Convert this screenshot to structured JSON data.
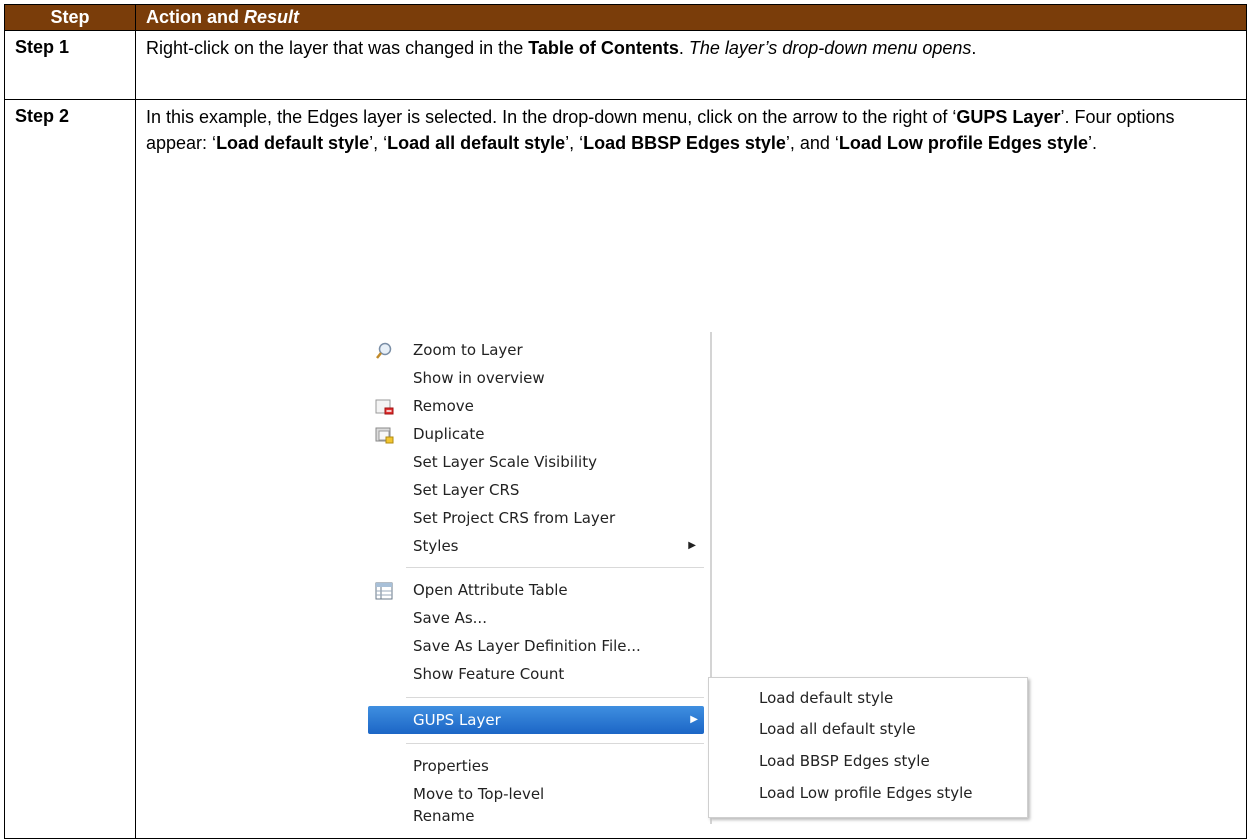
{
  "table": {
    "header": {
      "col1": "Step",
      "col2_plain": "Action and ",
      "col2_italic": "Result"
    },
    "step1": {
      "label": "Step 1",
      "t1": "Right-click on the layer that was changed in the ",
      "b1": "Table of Contents",
      "t2": ". ",
      "i1": "The layer’s drop-down menu opens",
      "t3": "."
    },
    "step2": {
      "label": "Step 2",
      "t1": "In this example, the Edges layer is selected. In the drop-down menu, click on the arrow to the right of ‘",
      "b1": "GUPS Layer",
      "t2": "’. Four options appear: ‘",
      "b2": "Load default style",
      "t3": "’, ‘",
      "b3": "Load all default style",
      "t4": "’, ‘",
      "b4": "Load BBSP Edges style",
      "t5": "’, and ‘",
      "b5": "Load Low profile Edges style",
      "t6": "’."
    }
  },
  "context_menu": {
    "items": [
      {
        "label": "Zoom to Layer",
        "icon": "zoom-icon"
      },
      {
        "label": "Show in overview"
      },
      {
        "label": "Remove",
        "icon": "remove-layer-icon"
      },
      {
        "label": "Duplicate",
        "icon": "duplicate-layer-icon"
      },
      {
        "label": "Set Layer Scale Visibility"
      },
      {
        "label": "Set Layer CRS"
      },
      {
        "label": "Set Project CRS from Layer"
      },
      {
        "label": "Styles",
        "submenu": true
      },
      {
        "label": "Open Attribute Table",
        "icon": "attribute-table-icon"
      },
      {
        "label": "Save As..."
      },
      {
        "label": "Save As Layer Definition File..."
      },
      {
        "label": "Show Feature Count"
      },
      {
        "label": "GUPS Layer",
        "submenu": true,
        "highlighted": true
      },
      {
        "label": "Properties"
      },
      {
        "label": "Move to Top-level"
      },
      {
        "label": "Rename"
      }
    ],
    "submenu_items": [
      {
        "label": "Load default style"
      },
      {
        "label": "Load all default style"
      },
      {
        "label": "Load BBSP Edges style"
      },
      {
        "label": "Load Low profile Edges style"
      }
    ]
  },
  "colors": {
    "header_bg": "#7a3d0a",
    "highlight": "#2a77d4"
  }
}
